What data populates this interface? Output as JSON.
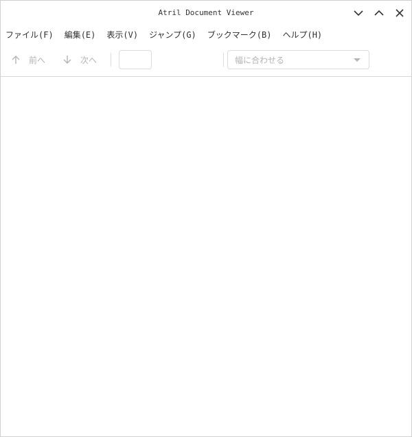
{
  "window": {
    "title": "Atril Document Viewer",
    "controls": [
      "minimize-icon",
      "maximize-icon",
      "close-icon"
    ]
  },
  "menubar": {
    "items": [
      {
        "label": "ファイル(F)"
      },
      {
        "label": "編集(E)"
      },
      {
        "label": "表示(V)"
      },
      {
        "label": "ジャンプ(G)"
      },
      {
        "label": "ブックマーク(B)"
      },
      {
        "label": "ヘルプ(H)"
      }
    ]
  },
  "toolbar": {
    "prev_label": "前へ",
    "next_label": "次へ",
    "page_value": "",
    "zoom_value": "幅に合わせる"
  },
  "colors": {
    "disabled_text": "#b4b4b4",
    "border": "#dcdcdc",
    "background": "#ffffff"
  }
}
